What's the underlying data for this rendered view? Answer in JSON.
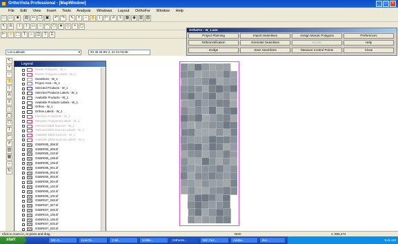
{
  "window": {
    "title": "OrthoVista Professional - [MapWindow]",
    "controls": [
      "_",
      "□",
      "×"
    ]
  },
  "menu": [
    "File",
    "Edit",
    "View",
    "Insert",
    "Tools",
    "Analysis",
    "Windows",
    "Layout",
    "OrthoFor",
    "Window",
    "Help"
  ],
  "orthofor": {
    "title": "OrthoFor - W_1.wor",
    "buttons": [
      {
        "label": "Project Planning",
        "enabled": true
      },
      {
        "label": "Import Seamlines",
        "enabled": true
      },
      {
        "label": "Assign Mosaic Polygons",
        "enabled": true
      },
      {
        "label": "Preferences",
        "enabled": true
      },
      {
        "label": "Orthorectification",
        "enabled": true
      },
      {
        "label": "Generate Seamlines",
        "enabled": true
      },
      {
        "label": "Mosaic",
        "enabled": false
      },
      {
        "label": "Help",
        "enabled": true
      },
      {
        "label": "Dodge",
        "enabled": true
      },
      {
        "label": "Save Seamlines",
        "enabled": true
      },
      {
        "label": "Measure Control Points",
        "enabled": true
      },
      {
        "label": "Close",
        "enabled": true
      }
    ]
  },
  "coordbar": {
    "layer": "Lon-Latitude",
    "readout": "20 35 26.0N 2, 22 24 03.5E"
  },
  "legend": {
    "title": "Legend",
    "items": [
      {
        "label": "Mosaic Polygons - W_1",
        "swatch": "#cc3366",
        "dim": true
      },
      {
        "label": "Mosaic Polygons Labels - W_1",
        "swatch": "#cc3366",
        "dim": true
      },
      {
        "label": "Seamlines - W_1",
        "swatch": "#9999cc",
        "dim": false
      },
      {
        "label": "Project Area - W_1",
        "swatch": "#d44fd4",
        "dim": false
      },
      {
        "label": "Selected Products - W_1",
        "swatch": "#3333aa",
        "dim": false
      },
      {
        "label": "Selected Products Labels - W_1",
        "swatch": "#3333aa",
        "dim": false
      },
      {
        "label": "Available Products - W_1",
        "swatch": "#555555",
        "dim": false
      },
      {
        "label": "Available Products Labels - W_1",
        "swatch": "#555555",
        "dim": false
      },
      {
        "label": "Orthos - W_1",
        "swatch": "#333333",
        "dim": false
      },
      {
        "label": "Orthos Labels - W_1",
        "swatch": "#333333",
        "dim": false
      },
      {
        "label": "Elevation Footprints - W_1",
        "swatch": "#cc3366",
        "dim": true
      },
      {
        "label": "Elevation Footprints Labels - W_1",
        "swatch": "#cc3366",
        "dim": true
      },
      {
        "label": "Selected DEM Sources - W_1",
        "swatch": "#cc3366",
        "dim": true
      },
      {
        "label": "Selected DEM Sources Labels - W_1",
        "swatch": "#cc3366",
        "dim": true
      },
      {
        "label": "Available DEM Sources - W_1",
        "swatch": "#cc3366",
        "dim": true
      },
      {
        "label": "Available DEM Sources Labels - W_1",
        "swatch": "#cc3366",
        "dim": true
      },
      {
        "label": "OSBR005_008.tif",
        "swatch": "#666666",
        "dim": false
      },
      {
        "label": "OSBR005_009.tif",
        "swatch": "#666666",
        "dim": false
      },
      {
        "label": "OSBR005_010.tif",
        "swatch": "#666666",
        "dim": false
      },
      {
        "label": "OSBR005_108.tif",
        "swatch": "#666666",
        "dim": false
      },
      {
        "label": "OSBR005_109.tif",
        "swatch": "#666666",
        "dim": false
      },
      {
        "label": "OSBR005_001.tif",
        "swatch": "#666666",
        "dim": false
      },
      {
        "label": "OSBR005_002.tif",
        "swatch": "#666666",
        "dim": false
      },
      {
        "label": "OSBR005_003.tif",
        "swatch": "#666666",
        "dim": false
      },
      {
        "label": "OSBR005_004.tif",
        "swatch": "#666666",
        "dim": false
      },
      {
        "label": "OSBR005_102.tif",
        "swatch": "#666666",
        "dim": false
      },
      {
        "label": "OSBR005_101.tif",
        "swatch": "#666666",
        "dim": false
      },
      {
        "label": "OSBR005_100.tif",
        "swatch": "#666666",
        "dim": false
      },
      {
        "label": "OSBR007_028.tif",
        "swatch": "#666666",
        "dim": false
      },
      {
        "label": "OSBR007_027.tif",
        "swatch": "#666666",
        "dim": false
      },
      {
        "label": "OSBR007_026.tif",
        "swatch": "#666666",
        "dim": false
      },
      {
        "label": "OSBR010_105.tif",
        "swatch": "#666666",
        "dim": false
      },
      {
        "label": "OSBR010_106.tif",
        "swatch": "#666666",
        "dim": false
      },
      {
        "label": "OSBR007_025.tif",
        "swatch": "#666666",
        "dim": false
      },
      {
        "label": "OSBR007_020.tif",
        "swatch": "#666666",
        "dim": false
      }
    ]
  },
  "status": {
    "hint": "Click to zoom in, or press and drag",
    "mode": "NOC",
    "scale": "1: 965,274"
  },
  "taskbar": {
    "start": "start",
    "tasks": [
      "Win D...",
      "How Di...",
      "2 Wi...",
      "Untitle...",
      "OrthoVis...",
      "Win Pict...",
      "Adobe...",
      "doc..."
    ],
    "clock": "9:41 AM"
  },
  "colors": {
    "project_area": "#d44fd4",
    "title_blue": "#0a4ec8",
    "taskbar_blue": "#245edb"
  }
}
